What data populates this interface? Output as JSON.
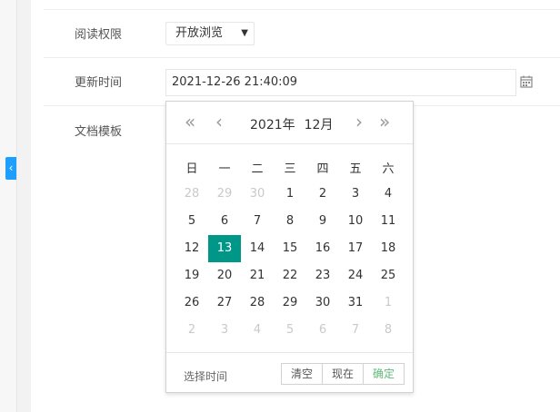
{
  "form": {
    "read_permission_label": "阅读权限",
    "read_permission_value": "开放浏览",
    "update_time_label": "更新时间",
    "update_time_value": "2021-12-26 21:40:09",
    "doc_template_label": "文档模板"
  },
  "datepicker": {
    "year_label": "2021年",
    "month_label": "12月",
    "weekdays": [
      "日",
      "一",
      "二",
      "三",
      "四",
      "五",
      "六"
    ],
    "weeks": [
      [
        "28",
        "29",
        "30",
        "1",
        "2",
        "3",
        "4"
      ],
      [
        "5",
        "6",
        "7",
        "8",
        "9",
        "10",
        "11"
      ],
      [
        "12",
        "13",
        "14",
        "15",
        "16",
        "17",
        "18"
      ],
      [
        "19",
        "20",
        "21",
        "22",
        "23",
        "24",
        "25"
      ],
      [
        "26",
        "27",
        "28",
        "29",
        "30",
        "31",
        "1"
      ],
      [
        "2",
        "3",
        "4",
        "5",
        "6",
        "7",
        "8"
      ]
    ],
    "selected_day": "13",
    "footer_text": "选择时间",
    "clear_label": "清空",
    "now_label": "现在",
    "confirm_label": "确定"
  },
  "icons": {
    "sidebar_toggle": "chevron-left-icon",
    "calendar": "calendar-icon",
    "prev_year": "double-chevron-left-icon",
    "prev_month": "chevron-left-icon",
    "next_month": "chevron-right-icon",
    "next_year": "double-chevron-right-icon"
  },
  "colors": {
    "selected_day": "#009688",
    "confirm": "#5FB878",
    "sidebar_toggle": "#1e9fff"
  }
}
